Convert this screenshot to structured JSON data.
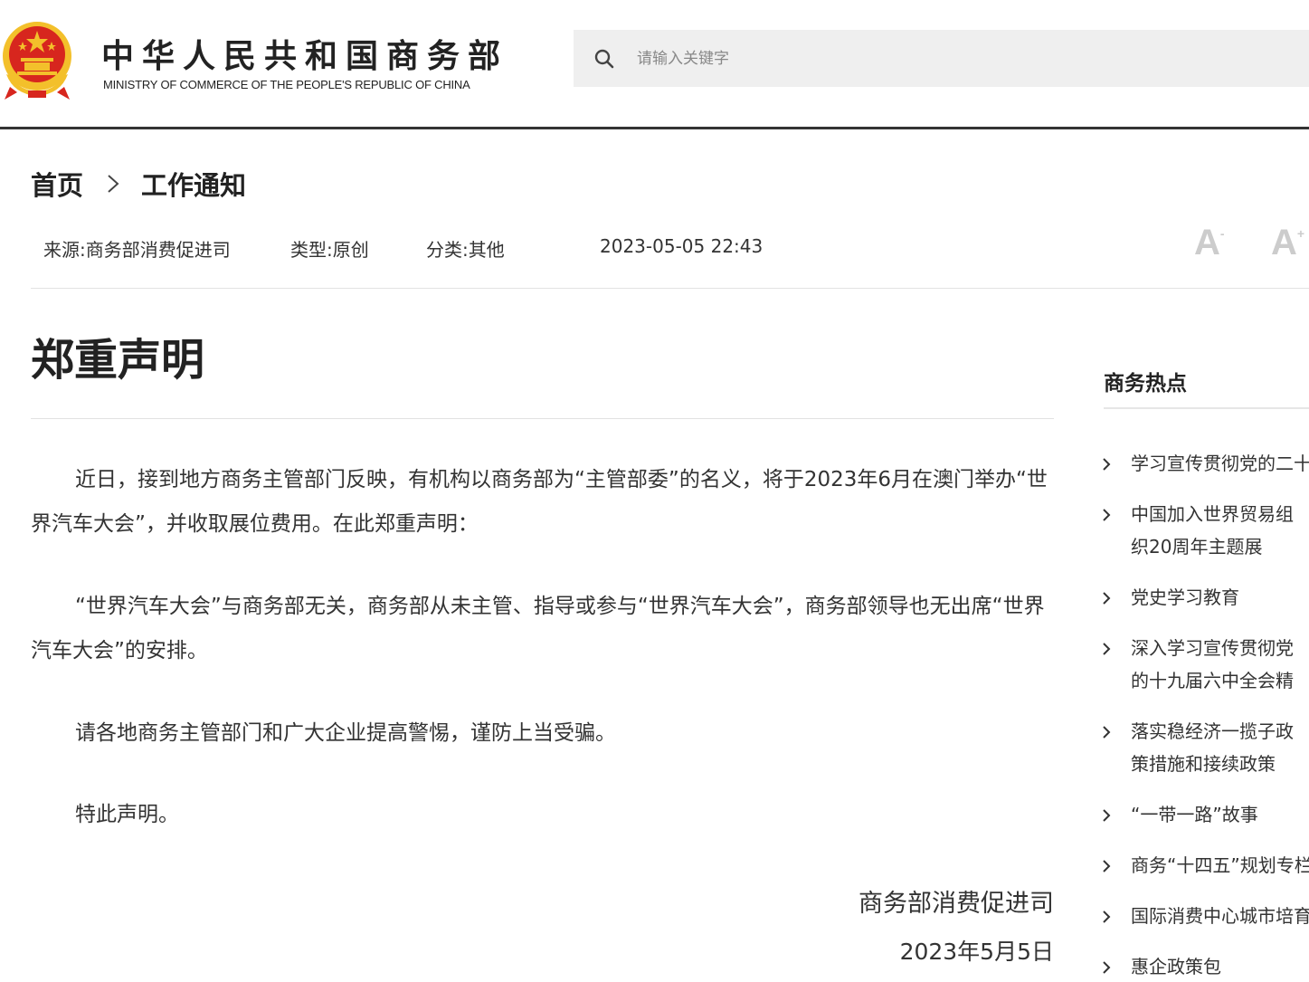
{
  "header": {
    "title": "中华人民共和国商务部",
    "subtitle": "MINISTRY OF COMMERCE OF THE PEOPLE'S REPUBLIC OF CHINA",
    "search_placeholder": "请输入关键字"
  },
  "breadcrumb": {
    "home": "首页",
    "current": "工作通知"
  },
  "meta": {
    "source_label": "来源:",
    "source": "商务部消费促进司",
    "type_label": "类型:",
    "type": "原创",
    "category_label": "分类:",
    "category": "其他",
    "datetime": "2023-05-05 22:43",
    "font_small": "A",
    "font_small_sign": "-",
    "font_large": "A",
    "font_large_sign": "+"
  },
  "article": {
    "title": "郑重声明",
    "paragraphs": [
      "近日，接到地方商务主管部门反映，有机构以商务部为“主管部委”的名义，将于2023年6月在澳门举办“世界汽车大会”，并收取展位费用。在此郑重声明：",
      "“世界汽车大会”与商务部无关，商务部从未主管、指导或参与“世界汽车大会”，商务部领导也无出席“世界汽车大会”的安排。",
      "请各地商务主管部门和广大企业提高警惕，谨防上当受骗。",
      "特此声明。"
    ],
    "signature": "商务部消费促进司",
    "date": "2023年5月5日"
  },
  "sidebar": {
    "title": "商务热点",
    "items": [
      "学习宣传贯彻党的二十大精神",
      "中国加入世界贸易组织20周年主题展",
      "党史学习教育",
      "深入学习宣传贯彻党的十九届六中全会精神",
      "落实稳经济一揽子政策措施和接续政策",
      "“一带一路”故事",
      "商务“十四五”规划专栏",
      "国际消费中心城市培育建设",
      "惠企政策包"
    ]
  },
  "colors": {
    "emblem_red": "#d7261e",
    "emblem_gold": "#f3c02b",
    "font_button": "#cccccc",
    "header_rule": "#333333"
  }
}
